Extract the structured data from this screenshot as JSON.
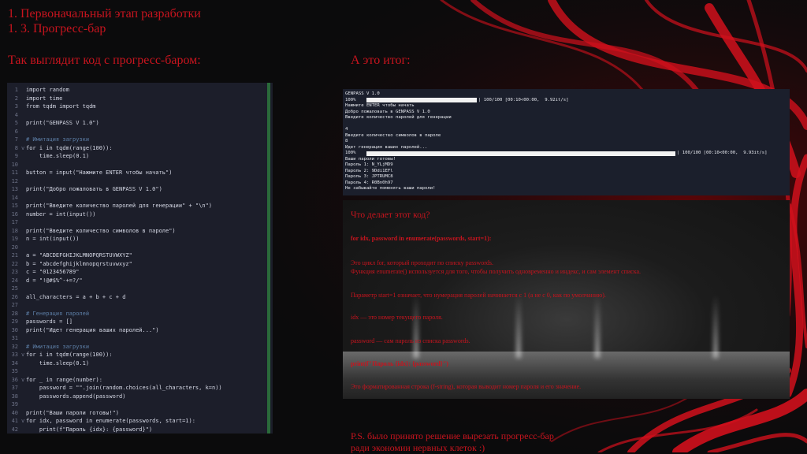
{
  "slide": {
    "title_line1": "1. Первоначальный этап разработки",
    "title_line2": "1. 3. Прогресс-бар",
    "left_heading": "Так выглядит код с прогресс-баром:",
    "right_heading": "А это итог:",
    "ps_line1": "P.S. было принято решение вырезать прогресс-бар",
    "ps_line2": "ради экономии нервных клеток :)"
  },
  "code": [
    {
      "n": "1",
      "t": "import random",
      "c": false,
      "f": ""
    },
    {
      "n": "2",
      "t": "import time",
      "c": false,
      "f": ""
    },
    {
      "n": "3",
      "t": "from tqdm import tqdm",
      "c": false,
      "f": ""
    },
    {
      "n": "4",
      "t": "",
      "c": false,
      "f": ""
    },
    {
      "n": "5",
      "t": "print(\"GENPASS V 1.0\")",
      "c": false,
      "f": ""
    },
    {
      "n": "6",
      "t": "",
      "c": false,
      "f": ""
    },
    {
      "n": "7",
      "t": "# Имитация загрузки",
      "c": true,
      "f": ""
    },
    {
      "n": "8",
      "t": "for i in tqdm(range(100)):",
      "c": false,
      "f": "v"
    },
    {
      "n": "9",
      "t": "    time.sleep(0.1)",
      "c": false,
      "f": ""
    },
    {
      "n": "10",
      "t": "",
      "c": false,
      "f": ""
    },
    {
      "n": "11",
      "t": "button = input(\"Нажмите ENTER чтобы начать\")",
      "c": false,
      "f": ""
    },
    {
      "n": "12",
      "t": "",
      "c": false,
      "f": ""
    },
    {
      "n": "13",
      "t": "print(\"Добро пожаловать в GENPASS V 1.0\")",
      "c": false,
      "f": ""
    },
    {
      "n": "14",
      "t": "",
      "c": false,
      "f": ""
    },
    {
      "n": "15",
      "t": "print(\"Введите количество паролей для генерации\" + \"\\n\")",
      "c": false,
      "f": ""
    },
    {
      "n": "16",
      "t": "number = int(input())",
      "c": false,
      "f": ""
    },
    {
      "n": "17",
      "t": "",
      "c": false,
      "f": ""
    },
    {
      "n": "18",
      "t": "print(\"Введите количество символов в пароле\")",
      "c": false,
      "f": ""
    },
    {
      "n": "19",
      "t": "n = int(input())",
      "c": false,
      "f": ""
    },
    {
      "n": "20",
      "t": "",
      "c": false,
      "f": ""
    },
    {
      "n": "21",
      "t": "a = \"ABCDEFGHIJKLMNOPQRSTUVWXYZ\"",
      "c": false,
      "f": ""
    },
    {
      "n": "22",
      "t": "b = \"abcdefghijklmnopqrstuvwxyz\"",
      "c": false,
      "f": ""
    },
    {
      "n": "23",
      "t": "c = \"0123456789\"",
      "c": false,
      "f": ""
    },
    {
      "n": "24",
      "t": "d = \"!@#$%^-+=?/\"",
      "c": false,
      "f": ""
    },
    {
      "n": "25",
      "t": "",
      "c": false,
      "f": ""
    },
    {
      "n": "26",
      "t": "all_characters = a + b + c + d",
      "c": false,
      "f": ""
    },
    {
      "n": "27",
      "t": "",
      "c": false,
      "f": ""
    },
    {
      "n": "28",
      "t": "# Генерация паролей",
      "c": true,
      "f": ""
    },
    {
      "n": "29",
      "t": "passwords = []",
      "c": false,
      "f": ""
    },
    {
      "n": "30",
      "t": "print(\"Идет генерация ваших паролей...\")",
      "c": false,
      "f": ""
    },
    {
      "n": "31",
      "t": "",
      "c": false,
      "f": ""
    },
    {
      "n": "32",
      "t": "# Имитация загрузки",
      "c": true,
      "f": ""
    },
    {
      "n": "33",
      "t": "for i in tqdm(range(100)):",
      "c": false,
      "f": "v"
    },
    {
      "n": "34",
      "t": "    time.sleep(0.1)",
      "c": false,
      "f": ""
    },
    {
      "n": "35",
      "t": "",
      "c": false,
      "f": ""
    },
    {
      "n": "36",
      "t": "for _ in range(number):",
      "c": false,
      "f": "v"
    },
    {
      "n": "37",
      "t": "    password = \"\".join(random.choices(all_characters, k=n))",
      "c": false,
      "f": ""
    },
    {
      "n": "38",
      "t": "    passwords.append(password)",
      "c": false,
      "f": ""
    },
    {
      "n": "39",
      "t": "",
      "c": false,
      "f": ""
    },
    {
      "n": "40",
      "t": "print(\"Ваши пароли готовы!\")",
      "c": false,
      "f": ""
    },
    {
      "n": "41",
      "t": "for idx, password in enumerate(passwords, start=1):",
      "c": false,
      "f": "v"
    },
    {
      "n": "42",
      "t": "    print(f\"Пароль {idx}: {password}\")",
      "c": false,
      "f": ""
    }
  ],
  "console": {
    "lines": [
      "GENPASS V 1.0",
      "100%",
      "Нажмите ENTER чтобы начать",
      "Добро пожаловать в GENPASS V 1.0",
      "Введите количество паролей для генерации",
      "",
      "4",
      "Введите количество символов в пароле",
      "8",
      "Идет генерация ваших паролей...",
      "100%",
      "Ваши пароли готовы!",
      "Пароль 1: N_YLjMD9",
      "Пароль 2: 9Ddi1EFl",
      "Пароль 3: JPTRUMC8",
      "Пароль 4: R0Bn0h97",
      "Не забывайте поменять ваши пароли!"
    ],
    "bar1_stats": "| 100/100 [00:10<00:00,  9.92it/s]",
    "bar2_stats": "| 100/100 [00:10<00:00,  9.93it/s]",
    "bar1_progress": 1.0,
    "bar2_progress": 1.0
  },
  "explain": {
    "question": "Что делает этот код?",
    "code1": "for idx, password in enumerate(passwords, start=1):",
    "p1a": "Это цикл for, который проходит по списку passwords.",
    "p1b": "Функция enumerate() используется для того, чтобы получить одновременно и индекс, и сам элемент списка.",
    "p2": "Параметр start=1 означает, что нумерация паролей начинается с 1 (а не с 0, как по умолчанию).",
    "p3": "idx — это номер текущего пароля.",
    "p4": "password — сам пароль из списка passwords.",
    "code2": "print(f\"Пароль {idx}: {password}\")",
    "p5": "Это форматированная строка (f-string), которая выводит номер пароля и его значение."
  },
  "colors": {
    "accent": "#c8141e",
    "editor_bg": "#1c1e2a",
    "console_bg": "#1b1f2c"
  }
}
